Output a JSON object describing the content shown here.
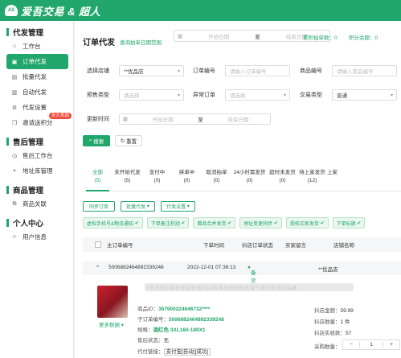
{
  "brand": {
    "logo_mark": "AS",
    "name": "爱吾交易 & 超人"
  },
  "sidebar": {
    "groups": [
      {
        "title": "代发管理",
        "items": [
          {
            "label": "工作台",
            "icon": "home-icon"
          },
          {
            "label": "订单代发",
            "icon": "cart-icon",
            "active": true
          },
          {
            "label": "批量代发",
            "icon": "upload-icon"
          },
          {
            "label": "自动代发",
            "icon": "auto-icon"
          },
          {
            "label": "代发设置",
            "icon": "gear-icon"
          },
          {
            "label": "邀请送积分",
            "icon": "gift-icon",
            "badge": "永久奖励"
          }
        ]
      },
      {
        "title": "售后管理",
        "items": [
          {
            "label": "售后工作台",
            "icon": "service-icon"
          },
          {
            "label": "地址库管理",
            "icon": "location-icon"
          }
        ]
      },
      {
        "title": "商品管理",
        "items": [
          {
            "label": "商品关联",
            "icon": "link-icon"
          }
        ]
      },
      {
        "title": "个人中心",
        "items": [
          {
            "label": "用户信息",
            "icon": "user-icon"
          }
        ]
      }
    ]
  },
  "header": {
    "title": "订单代发",
    "query_label": "查询拍单日期范围",
    "date_start_placeholder": "开始日期",
    "date_sep": "至",
    "date_end_placeholder": "结束日期",
    "stat_orders": "累积拍单数：0",
    "stat_points": "积分余额：0"
  },
  "filters": {
    "shop_label": "选择店铺",
    "shop_value": "**优品店",
    "order_no_label": "订单编号",
    "order_no_placeholder": "请输入订单编号",
    "product_no_label": "商品编号",
    "product_no_placeholder": "请输入商品编号",
    "presale_label": "预售类型",
    "presale_placeholder": "请选择",
    "abnormal_label": "异常订单",
    "abnormal_placeholder": "请选择",
    "trade_type_label": "交易类型",
    "trade_type_value": "普通",
    "update_time_label": "更新时间",
    "update_start": "开始日期",
    "update_sep": "至",
    "update_end": "结束日期",
    "search_label": "搜索",
    "reset_label": "重置"
  },
  "tabs": [
    {
      "label": "全部",
      "count": "(5)",
      "active": true
    },
    {
      "label": "未开始代发",
      "count": "(5)"
    },
    {
      "label": "支付中",
      "count": "(0)"
    },
    {
      "label": "拼单中",
      "count": "(0)"
    },
    {
      "label": "取消拍单",
      "count": "(0)"
    },
    {
      "label": "24小时需发货",
      "count": "(0)"
    },
    {
      "label": "超时未发货",
      "count": "(0)"
    },
    {
      "label": "待上家发货",
      "count": "(12)"
    },
    {
      "label": "上家",
      "count": ""
    }
  ],
  "actions": {
    "sync": "同步订单",
    "batch": "批量代发",
    "settings": "代发设置"
  },
  "feature_tags": [
    "虚拟手机号&物流通知",
    "下单备注利润",
    "赠品合并发货",
    "地址变更同步",
    "授权买家发货",
    "下单标旗"
  ],
  "table": {
    "headers": [
      "主订单编号",
      "下单时间",
      "抖店订单状态",
      "买家留言",
      "店铺名称"
    ],
    "order": {
      "order_no": "5006882464892339248",
      "order_time": "2022-12-01 07:36:13",
      "status": "备货中",
      "shop": "**优品店"
    },
    "product": {
      "title": "1号大码女装针织连衣裙2022秋冬长款宽松显瘦气质小香风打底裙",
      "product_id_label": "商品ID：",
      "product_id": "357900224646732****",
      "sub_order_label": "子订单编号：",
      "sub_order": "5006882464892339248",
      "spec_label": "规格：",
      "spec": "酒红色 3XL160-180X1",
      "after_sale_label": "售后状态：",
      "after_sale": "无",
      "pay_link_label": "代付链接：",
      "pay_link": "支付宝[自动][成功]",
      "more": "更多数据",
      "price_label": "抖店金额：",
      "price": "59.99",
      "qty_label": "抖店数量：",
      "qty": "1 件",
      "actual_label": "抖店实收款：",
      "actual": "57",
      "purchase_qty_label": "采购数量：",
      "purchase_qty": "1"
    }
  }
}
